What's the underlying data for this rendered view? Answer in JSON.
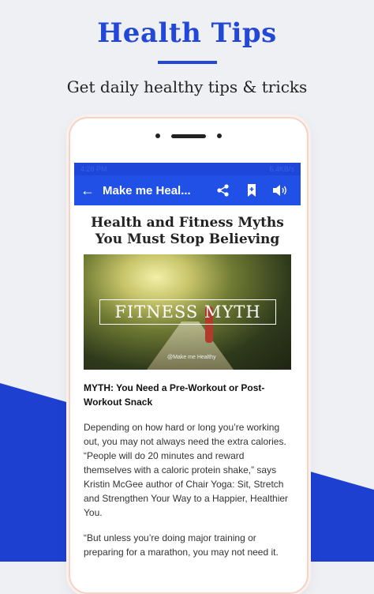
{
  "promo": {
    "headline": "Health Tips",
    "subheadline": "Get daily healthy tips & tricks"
  },
  "status_bar": {
    "time": "4:28 PM",
    "network": "6.4KB/s"
  },
  "app_bar": {
    "title": "Make me Heal...",
    "icons": [
      "back-arrow-icon",
      "share-icon",
      "bookmark-icon",
      "speaker-icon"
    ]
  },
  "article": {
    "title": "Health and Fitness Myths You Must Stop Believing",
    "image_text": "FITNESS MYTH",
    "image_credit": "@Make me Healthy",
    "subheading": "MYTH: You Need a Pre-Workout or Post-Workout Snack",
    "paragraph_1": "Depending on how hard or long you’re working out, you may not always need the extra calories. “People will do 20 minutes and reward themselves with a caloric protein shake,” says Kristin McGee author of Chair Yoga: Sit, Stretch and Strengthen Your Way to a Happier, Healthier You.",
    "paragraph_2": "“But unless you’re doing major training or preparing for a marathon, you may not need it."
  },
  "colors": {
    "accent": "#2347d6",
    "app_bar": "#2150e6",
    "fab": "#f39a1b"
  }
}
